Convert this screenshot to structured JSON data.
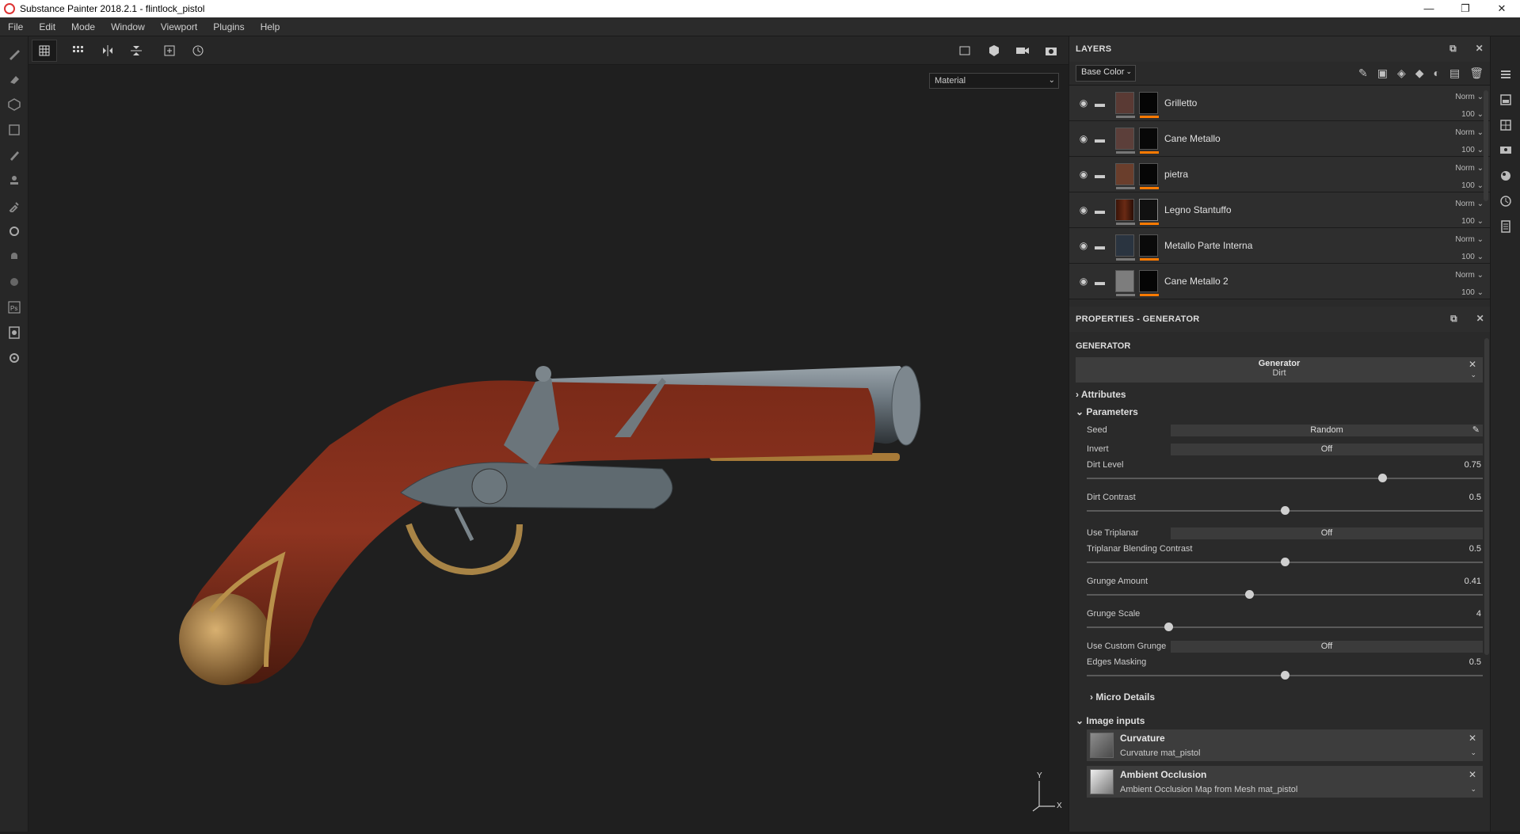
{
  "window": {
    "title": "Substance Painter 2018.2.1 - flintlock_pistol",
    "controls": [
      "—",
      "❐",
      "✕"
    ]
  },
  "menu": [
    "File",
    "Edit",
    "Mode",
    "Window",
    "Viewport",
    "Plugins",
    "Help"
  ],
  "viewport": {
    "material_mode": "Material",
    "axis_y": "Y",
    "axis_x": "X"
  },
  "layers_panel": {
    "title": "LAYERS",
    "channel": "Base Color",
    "layers": [
      {
        "name": "Grilletto",
        "blend": "Norm",
        "opacity": "100"
      },
      {
        "name": "Cane Metallo",
        "blend": "Norm",
        "opacity": "100"
      },
      {
        "name": "pietra",
        "blend": "Norm",
        "opacity": "100"
      },
      {
        "name": "Legno Stantuffo",
        "blend": "Norm",
        "opacity": "100"
      },
      {
        "name": "Metallo Parte Interna",
        "blend": "Norm",
        "opacity": "100"
      },
      {
        "name": "Cane Metallo 2",
        "blend": "Norm",
        "opacity": "100"
      }
    ]
  },
  "properties": {
    "title": "PROPERTIES - GENERATOR",
    "section": "GENERATOR",
    "generator_title": "Generator",
    "generator_value": "Dirt",
    "attributes": "Attributes",
    "parameters": "Parameters",
    "seed_label": "Seed",
    "seed_value": "Random",
    "invert_label": "Invert",
    "invert_value": "Off",
    "dirt_level_label": "Dirt Level",
    "dirt_level_value": "0.75",
    "dirt_contrast_label": "Dirt Contrast",
    "dirt_contrast_value": "0.5",
    "use_triplanar_label": "Use Triplanar",
    "use_triplanar_value": "Off",
    "triplanar_blend_label": "Triplanar Blending Contrast",
    "triplanar_blend_value": "0.5",
    "grunge_amount_label": "Grunge Amount",
    "grunge_amount_value": "0.41",
    "grunge_scale_label": "Grunge Scale",
    "grunge_scale_value": "4",
    "use_custom_grunge_label": "Use Custom Grunge",
    "use_custom_grunge_value": "Off",
    "edges_masking_label": "Edges Masking",
    "edges_masking_value": "0.5",
    "micro_details": "Micro Details",
    "image_inputs": "Image inputs",
    "inputs": [
      {
        "title": "Curvature",
        "source": "Curvature mat_pistol"
      },
      {
        "title": "Ambient Occlusion",
        "source": "Ambient Occlusion Map from Mesh mat_pistol"
      }
    ]
  }
}
